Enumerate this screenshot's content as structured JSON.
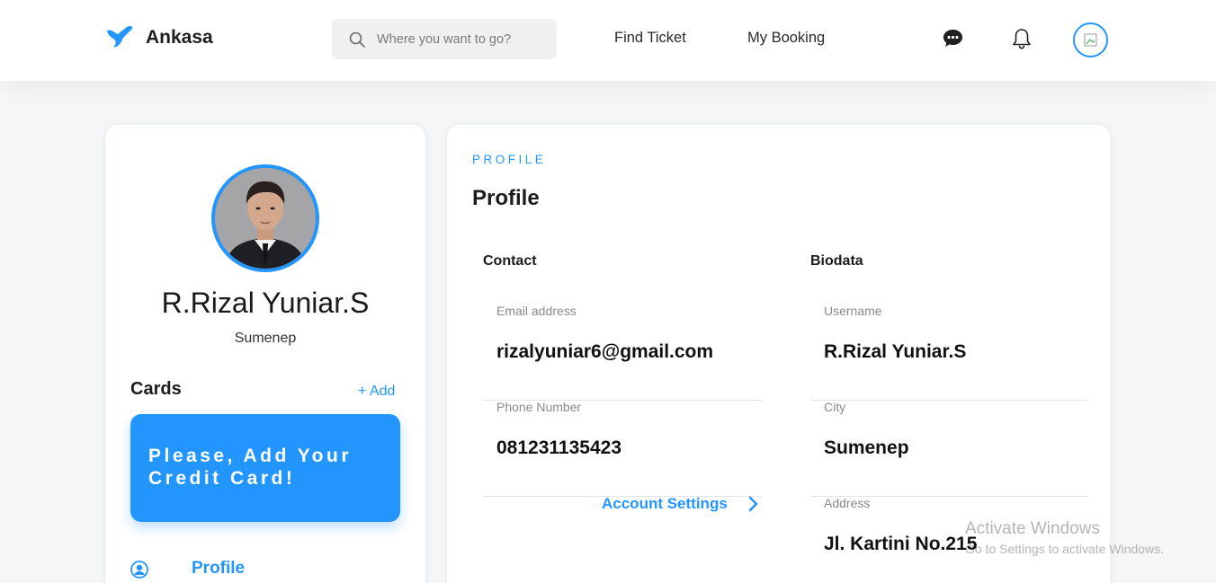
{
  "header": {
    "brand_name": "Ankasa",
    "search_placeholder": "Where you want to go?",
    "nav_find_ticket": "Find Ticket",
    "nav_my_booking": "My Booking",
    "accent_color": "#2395ff"
  },
  "sidebar": {
    "name": "R.Rizal Yuniar.S",
    "city": "Sumenep",
    "cards_title": "Cards",
    "cards_add": "+ Add",
    "card_message": "Please, Add Your Credit Card!",
    "menu_profile": "Profile"
  },
  "main": {
    "section_tag": "PROFILE",
    "section_title": "Profile",
    "contact": {
      "title": "Contact",
      "email_label": "Email address",
      "email_value": "rizalyuniar6@gmail.com",
      "phone_label": "Phone Number",
      "phone_value": "081231135423",
      "account_settings": "Account Settings"
    },
    "biodata": {
      "title": "Biodata",
      "username_label": "Username",
      "username_value": "R.Rizal Yuniar.S",
      "city_label": "City",
      "city_value": "Sumenep",
      "address_label": "Address",
      "address_value": "Jl. Kartini No.215"
    }
  },
  "watermark": {
    "line1": "Activate Windows",
    "line2": "Go to Settings to activate Windows."
  }
}
